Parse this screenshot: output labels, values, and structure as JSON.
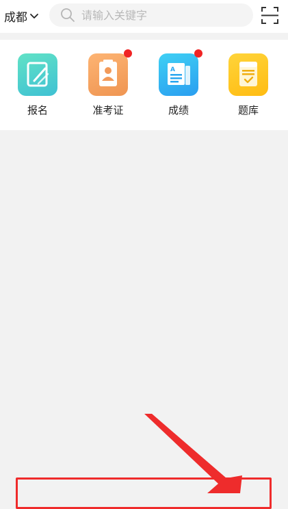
{
  "header": {
    "city": "成都",
    "search_placeholder": "请输入关键字"
  },
  "quick_menu": [
    {
      "label": "报名",
      "icon": "edit-icon",
      "badge": false,
      "color": "#4fd3c2"
    },
    {
      "label": "准考证",
      "icon": "id-card-icon",
      "badge": true,
      "color": "#f6a560"
    },
    {
      "label": "成绩",
      "icon": "report-icon",
      "badge": true,
      "color": "#32b7f0"
    },
    {
      "label": "题库",
      "icon": "question-bank-icon",
      "badge": false,
      "color": "#ffc823"
    }
  ],
  "colors": {
    "badge": "#f02424",
    "annotation": "#ef2b2b",
    "background": "#f2f2f2"
  }
}
